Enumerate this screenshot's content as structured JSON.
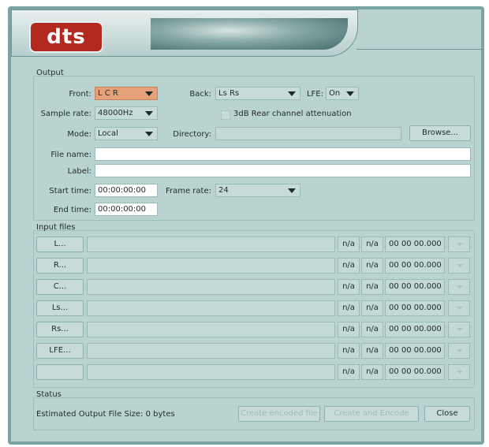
{
  "brand": {
    "logo_text": "dts"
  },
  "output": {
    "section_title": "Output",
    "front_label": "Front:",
    "front_value": "L C R",
    "back_label": "Back:",
    "back_value": "Ls Rs",
    "lfe_label": "LFE:",
    "lfe_value": "On",
    "sample_rate_label": "Sample rate:",
    "sample_rate_value": "48000Hz",
    "rear_attenuation_label": "3dB Rear channel attenuation",
    "mode_label": "Mode:",
    "mode_value": "Local",
    "directory_label": "Directory:",
    "directory_value": "",
    "browse_label": "Browse...",
    "file_name_label": "File name:",
    "file_name_value": "",
    "label_label": "Label:",
    "label_value": "",
    "start_time_label": "Start time:",
    "start_time_value": "00:00:00:00",
    "frame_rate_label": "Frame rate:",
    "frame_rate_value": "24",
    "end_time_label": "End time:",
    "end_time_value": "00:00:00:00"
  },
  "input_files": {
    "section_title": "Input files",
    "rows": [
      {
        "button": "L...",
        "col1": "n/a",
        "col2": "n/a",
        "time": "00 00 00.000"
      },
      {
        "button": "R...",
        "col1": "n/a",
        "col2": "n/a",
        "time": "00 00 00.000"
      },
      {
        "button": "C...",
        "col1": "n/a",
        "col2": "n/a",
        "time": "00 00 00.000"
      },
      {
        "button": "Ls...",
        "col1": "n/a",
        "col2": "n/a",
        "time": "00 00 00.000"
      },
      {
        "button": "Rs...",
        "col1": "n/a",
        "col2": "n/a",
        "time": "00 00 00.000"
      },
      {
        "button": "LFE...",
        "col1": "n/a",
        "col2": "n/a",
        "time": "00 00 00.000"
      },
      {
        "button": "",
        "col1": "n/a",
        "col2": "n/a",
        "time": "00 00 00.000"
      }
    ]
  },
  "status": {
    "section_title": "Status",
    "estimated_size": "Estimated Output File Size: 0 bytes",
    "disabled_button_1": "Create encoded file",
    "disabled_button_2": "Create and Encode",
    "close_label": "Close"
  }
}
